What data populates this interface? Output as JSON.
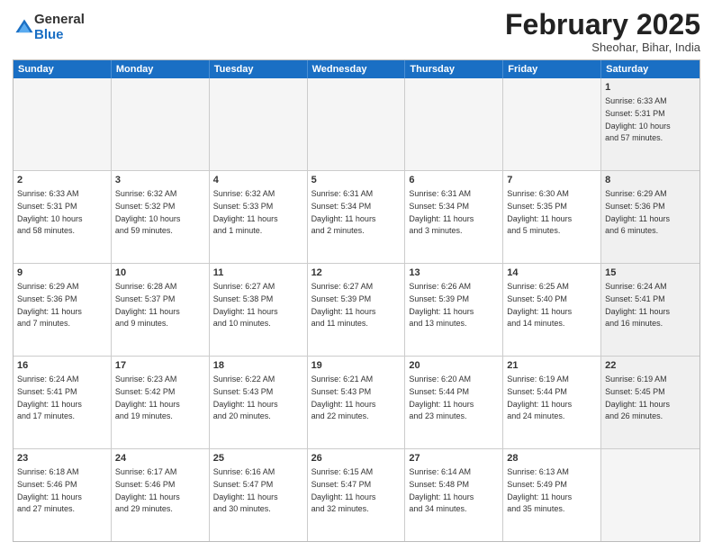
{
  "logo": {
    "general": "General",
    "blue": "Blue"
  },
  "title": "February 2025",
  "subtitle": "Sheohar, Bihar, India",
  "days": [
    "Sunday",
    "Monday",
    "Tuesday",
    "Wednesday",
    "Thursday",
    "Friday",
    "Saturday"
  ],
  "rows": [
    [
      {
        "day": "",
        "text": "",
        "empty": true
      },
      {
        "day": "",
        "text": "",
        "empty": true
      },
      {
        "day": "",
        "text": "",
        "empty": true
      },
      {
        "day": "",
        "text": "",
        "empty": true
      },
      {
        "day": "",
        "text": "",
        "empty": true
      },
      {
        "day": "",
        "text": "",
        "empty": true
      },
      {
        "day": "1",
        "text": "Sunrise: 6:33 AM\nSunset: 5:31 PM\nDaylight: 10 hours\nand 57 minutes.",
        "gray": true
      }
    ],
    [
      {
        "day": "2",
        "text": "Sunrise: 6:33 AM\nSunset: 5:31 PM\nDaylight: 10 hours\nand 58 minutes.",
        "gray": false
      },
      {
        "day": "3",
        "text": "Sunrise: 6:32 AM\nSunset: 5:32 PM\nDaylight: 10 hours\nand 59 minutes.",
        "gray": false
      },
      {
        "day": "4",
        "text": "Sunrise: 6:32 AM\nSunset: 5:33 PM\nDaylight: 11 hours\nand 1 minute.",
        "gray": false
      },
      {
        "day": "5",
        "text": "Sunrise: 6:31 AM\nSunset: 5:34 PM\nDaylight: 11 hours\nand 2 minutes.",
        "gray": false
      },
      {
        "day": "6",
        "text": "Sunrise: 6:31 AM\nSunset: 5:34 PM\nDaylight: 11 hours\nand 3 minutes.",
        "gray": false
      },
      {
        "day": "7",
        "text": "Sunrise: 6:30 AM\nSunset: 5:35 PM\nDaylight: 11 hours\nand 5 minutes.",
        "gray": false
      },
      {
        "day": "8",
        "text": "Sunrise: 6:29 AM\nSunset: 5:36 PM\nDaylight: 11 hours\nand 6 minutes.",
        "gray": true
      }
    ],
    [
      {
        "day": "9",
        "text": "Sunrise: 6:29 AM\nSunset: 5:36 PM\nDaylight: 11 hours\nand 7 minutes.",
        "gray": false
      },
      {
        "day": "10",
        "text": "Sunrise: 6:28 AM\nSunset: 5:37 PM\nDaylight: 11 hours\nand 9 minutes.",
        "gray": false
      },
      {
        "day": "11",
        "text": "Sunrise: 6:27 AM\nSunset: 5:38 PM\nDaylight: 11 hours\nand 10 minutes.",
        "gray": false
      },
      {
        "day": "12",
        "text": "Sunrise: 6:27 AM\nSunset: 5:39 PM\nDaylight: 11 hours\nand 11 minutes.",
        "gray": false
      },
      {
        "day": "13",
        "text": "Sunrise: 6:26 AM\nSunset: 5:39 PM\nDaylight: 11 hours\nand 13 minutes.",
        "gray": false
      },
      {
        "day": "14",
        "text": "Sunrise: 6:25 AM\nSunset: 5:40 PM\nDaylight: 11 hours\nand 14 minutes.",
        "gray": false
      },
      {
        "day": "15",
        "text": "Sunrise: 6:24 AM\nSunset: 5:41 PM\nDaylight: 11 hours\nand 16 minutes.",
        "gray": true
      }
    ],
    [
      {
        "day": "16",
        "text": "Sunrise: 6:24 AM\nSunset: 5:41 PM\nDaylight: 11 hours\nand 17 minutes.",
        "gray": false
      },
      {
        "day": "17",
        "text": "Sunrise: 6:23 AM\nSunset: 5:42 PM\nDaylight: 11 hours\nand 19 minutes.",
        "gray": false
      },
      {
        "day": "18",
        "text": "Sunrise: 6:22 AM\nSunset: 5:43 PM\nDaylight: 11 hours\nand 20 minutes.",
        "gray": false
      },
      {
        "day": "19",
        "text": "Sunrise: 6:21 AM\nSunset: 5:43 PM\nDaylight: 11 hours\nand 22 minutes.",
        "gray": false
      },
      {
        "day": "20",
        "text": "Sunrise: 6:20 AM\nSunset: 5:44 PM\nDaylight: 11 hours\nand 23 minutes.",
        "gray": false
      },
      {
        "day": "21",
        "text": "Sunrise: 6:19 AM\nSunset: 5:44 PM\nDaylight: 11 hours\nand 24 minutes.",
        "gray": false
      },
      {
        "day": "22",
        "text": "Sunrise: 6:19 AM\nSunset: 5:45 PM\nDaylight: 11 hours\nand 26 minutes.",
        "gray": true
      }
    ],
    [
      {
        "day": "23",
        "text": "Sunrise: 6:18 AM\nSunset: 5:46 PM\nDaylight: 11 hours\nand 27 minutes.",
        "gray": false
      },
      {
        "day": "24",
        "text": "Sunrise: 6:17 AM\nSunset: 5:46 PM\nDaylight: 11 hours\nand 29 minutes.",
        "gray": false
      },
      {
        "day": "25",
        "text": "Sunrise: 6:16 AM\nSunset: 5:47 PM\nDaylight: 11 hours\nand 30 minutes.",
        "gray": false
      },
      {
        "day": "26",
        "text": "Sunrise: 6:15 AM\nSunset: 5:47 PM\nDaylight: 11 hours\nand 32 minutes.",
        "gray": false
      },
      {
        "day": "27",
        "text": "Sunrise: 6:14 AM\nSunset: 5:48 PM\nDaylight: 11 hours\nand 34 minutes.",
        "gray": false
      },
      {
        "day": "28",
        "text": "Sunrise: 6:13 AM\nSunset: 5:49 PM\nDaylight: 11 hours\nand 35 minutes.",
        "gray": false
      },
      {
        "day": "",
        "text": "",
        "empty": true,
        "gray": true
      }
    ]
  ]
}
